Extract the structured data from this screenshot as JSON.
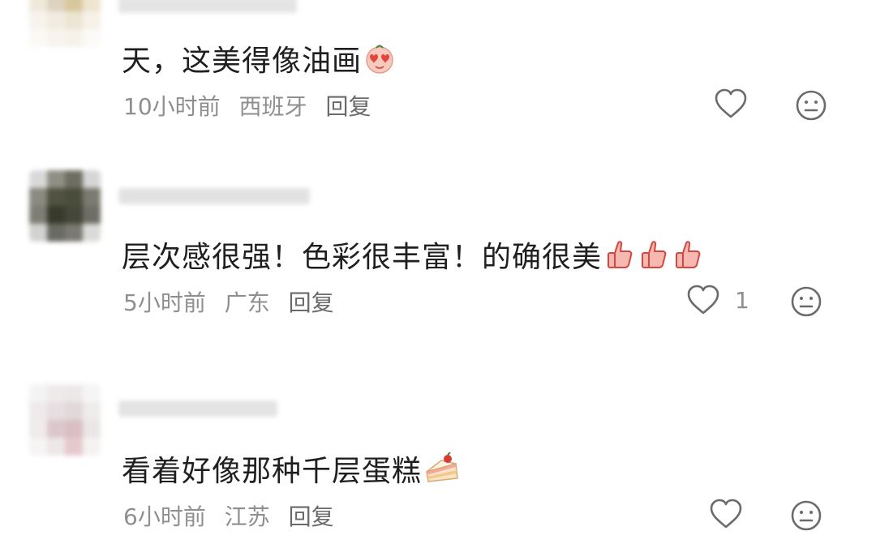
{
  "comments": [
    {
      "text": "天，这美得像油画",
      "emoji": [
        "heart-eyes-emoji"
      ],
      "time": "10小时前",
      "location": "西班牙",
      "reply_label": "回复",
      "likes": ""
    },
    {
      "text": "层次感很强！色彩很丰富！的确很美",
      "emoji": [
        "thumbs-up-emoji",
        "thumbs-up-emoji",
        "thumbs-up-emoji"
      ],
      "time": "5小时前",
      "location": "广东",
      "reply_label": "回复",
      "likes": "1"
    },
    {
      "text": "看着好像那种千层蛋糕",
      "emoji": [
        "cake-emoji"
      ],
      "time": "6小时前",
      "location": "江苏",
      "reply_label": "回复",
      "likes": ""
    }
  ],
  "colors": {
    "text": "#1f1f1f",
    "meta": "#8f8f8f",
    "icon": "#6b6b6b"
  }
}
